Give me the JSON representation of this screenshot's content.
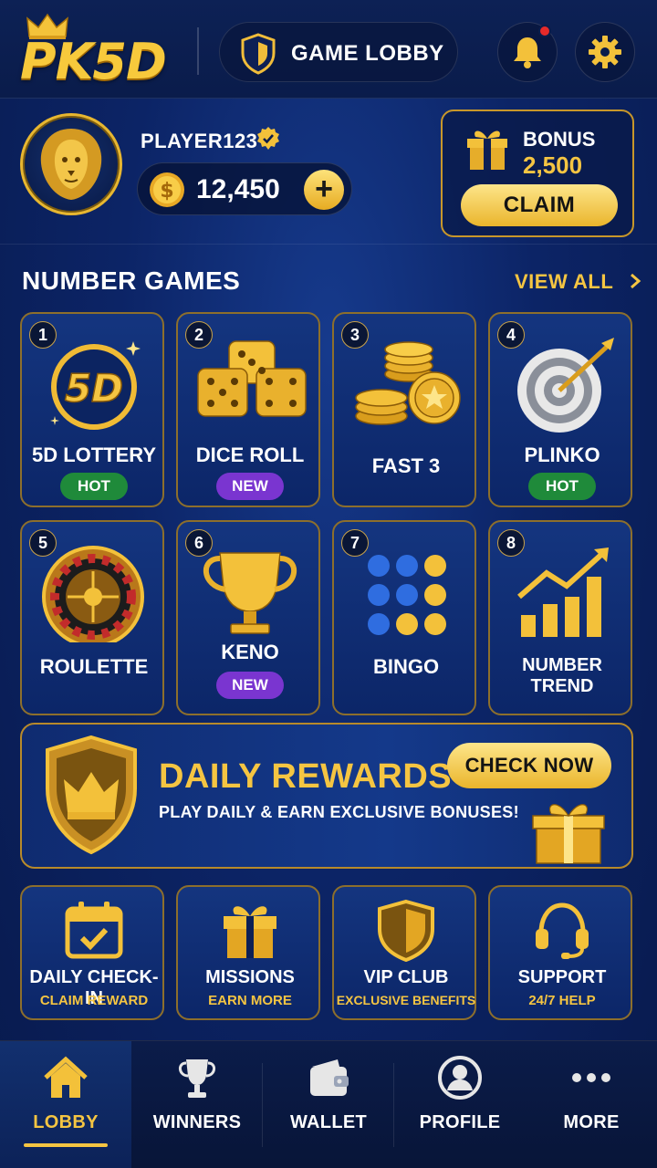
{
  "header": {
    "logo_text": "PK5D",
    "lobby_label": "GAME LOBBY",
    "icons": [
      "crown-icon",
      "shield-icon",
      "bell-icon",
      "gear-icon"
    ]
  },
  "profile": {
    "username": "PLAYER123",
    "balance": "12,450",
    "add_label": "+"
  },
  "bonus": {
    "label": "BONUS",
    "amount": "2,500",
    "claim_label": "CLAIM"
  },
  "games_section": {
    "title": "NUMBER GAMES",
    "view_all": "VIEW ALL",
    "games": [
      {
        "num": "1",
        "name": "5D LOTTERY",
        "badge": "HOT",
        "art_text": "5D"
      },
      {
        "num": "2",
        "name": "DICE ROLL",
        "badge": "NEW"
      },
      {
        "num": "3",
        "name": "FAST 3",
        "badge": ""
      },
      {
        "num": "4",
        "name": "PLINKO",
        "badge": "HOT"
      },
      {
        "num": "5",
        "name": "ROULETTE",
        "badge": ""
      },
      {
        "num": "6",
        "name": "KENO",
        "badge": "NEW"
      },
      {
        "num": "7",
        "name": "BINGO",
        "badge": ""
      },
      {
        "num": "8",
        "name": "NUMBER TREND",
        "badge": ""
      }
    ]
  },
  "rewards": {
    "title": "DAILY REWARDS",
    "subtitle": "PLAY DAILY & EARN EXCLUSIVE BONUSES!",
    "button": "CHECK NOW"
  },
  "quick_actions": [
    {
      "title": "DAILY CHECK-IN",
      "sub": "CLAIM REWARD"
    },
    {
      "title": "MISSIONS",
      "sub": "EARN MORE"
    },
    {
      "title": "VIP CLUB",
      "sub": "EXCLUSIVE BENEFITS"
    },
    {
      "title": "SUPPORT",
      "sub": "24/7 HELP"
    }
  ],
  "nav": [
    {
      "label": "LOBBY",
      "active": true
    },
    {
      "label": "WINNERS",
      "active": false
    },
    {
      "label": "WALLET",
      "active": false
    },
    {
      "label": "PROFILE",
      "active": false
    },
    {
      "label": "MORE",
      "active": false
    }
  ],
  "colors": {
    "gold": "#f5c542",
    "background": "#0c2466",
    "hot": "#1f8a3a",
    "new": "#7a35d0",
    "notification": "#e62a2a"
  }
}
